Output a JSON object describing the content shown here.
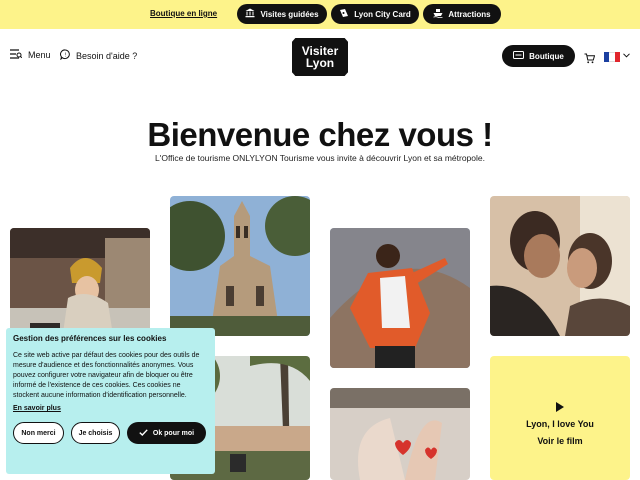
{
  "topbar": {
    "shop_link": "Boutique en ligne",
    "pills": [
      {
        "label": "Visites guidées",
        "icon": "museum-icon"
      },
      {
        "label": "Lyon City Card",
        "icon": "ticket-icon"
      },
      {
        "label": "Attractions",
        "icon": "boat-icon"
      }
    ]
  },
  "header": {
    "menu_label": "Menu",
    "help_label": "Besoin d'aide ?",
    "logo_line1": "Visiter",
    "logo_line2": "Lyon",
    "shop_button": "Boutique",
    "language": "FR"
  },
  "hero": {
    "title": "Bienvenue chez vous !",
    "subtitle": "L'Office de tourisme ONLYLYON Tourisme vous invite à découvrir Lyon et sa métropole."
  },
  "video_card": {
    "line1": "Lyon, I love You",
    "line2": "Voir le film"
  },
  "cookie_banner": {
    "title": "Gestion des préférences sur les cookies",
    "text": "Ce site web active par défaut des cookies pour des outils de mesure d'audience et des fonctionnalités anonymes. Vous pouvez configurer votre navigateur afin de bloquer ou être informé de l'existence de ces cookies. Ces cookies ne stockent aucune information d'identification personnelle.",
    "learn_more": "En savoir plus",
    "refuse": "Non merci",
    "choose": "Je choisis",
    "accept": "Ok pour moi"
  },
  "colors": {
    "brand_yellow": "#fdf38a",
    "cookie_bg": "#b7efee",
    "dark": "#111111"
  }
}
